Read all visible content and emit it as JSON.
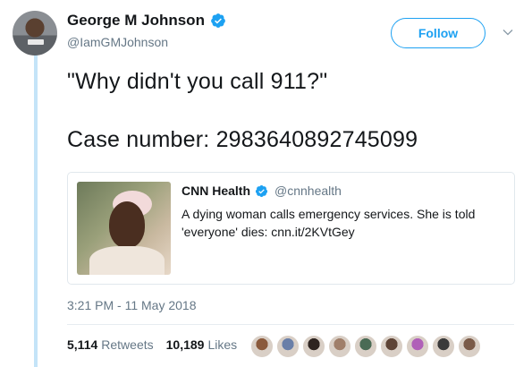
{
  "author": {
    "display_name": "George M Johnson",
    "handle": "@IamGMJohnson",
    "verified": true
  },
  "follow_button": {
    "label": "Follow"
  },
  "tweet": {
    "line1": "\"Why didn't you call 911?\"",
    "line2": "Case number: 2983640892745099"
  },
  "quoted_tweet": {
    "display_name": "CNN Health",
    "handle": "@cnnhealth",
    "verified": true,
    "text": "A dying woman calls emergency services. She is told 'everyone' dies: cnn.it/2KVtGey"
  },
  "timestamp": "3:21 PM - 11 May 2018",
  "stats": {
    "retweets_count": "5,114",
    "retweets_label": "Retweets",
    "likes_count": "10,189",
    "likes_label": "Likes"
  },
  "colors": {
    "accent": "#1da1f2",
    "secondary_text": "#657786",
    "thread_line": "#c4e4f8"
  },
  "liker_avatars": [
    "#8b5a3c",
    "#6a7fa8",
    "#2e2420",
    "#a07f6a",
    "#4a6b55",
    "#5e4436",
    "#b060b8",
    "#3a3a3a",
    "#7a5a48"
  ]
}
